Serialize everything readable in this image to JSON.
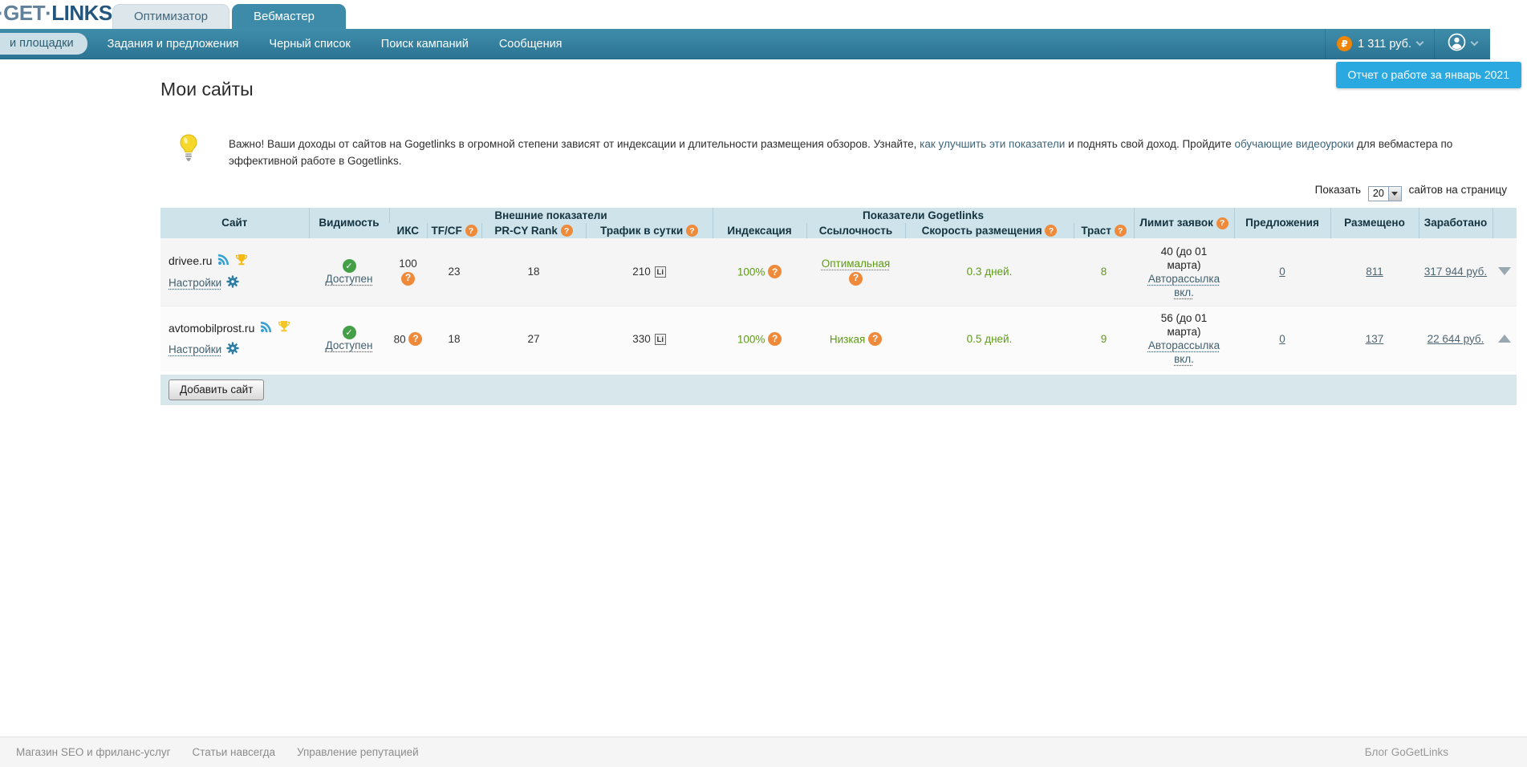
{
  "colors": {
    "accent_teal": "#35819f",
    "notification_blue": "#2aa9e0",
    "success_green": "#5d9c12",
    "badge_orange": "#ef8a3a",
    "trophy_gold": "#f2b61c"
  },
  "brand": {
    "prefix": "·GET·",
    "name": "LINKS"
  },
  "tabs": {
    "optimizer": "Оптимизатор",
    "webmaster": "Вебмастер"
  },
  "nav": {
    "item_platforms": "и площадки",
    "item_tasks": "Задания и предложения",
    "item_blacklist": "Черный список",
    "item_search": "Поиск кампаний",
    "item_messages": "Сообщения",
    "ruble": "₽",
    "balance": "1 311 руб."
  },
  "notification": {
    "text": "Отчет о работе за январь 2021"
  },
  "page": {
    "title": "Мои сайты"
  },
  "notice": {
    "part1": "Важно! Ваши доходы от сайтов на Gogetlinks в огромной степени зависят от индексации и длительности размещения обзоров. Узнайте, ",
    "link1": "как улучшить эти показатели",
    "part2": " и поднять свой доход. Пройдите ",
    "link2": "обучающие видеоуроки",
    "part3": " для вебмастера по эффективной работе в Gogetlinks."
  },
  "per_page": {
    "before": "Показать",
    "value": "20",
    "after": "сайтов на страницу"
  },
  "icons": {
    "question": "?",
    "check": "✓",
    "li": "Li"
  },
  "table": {
    "group_external": "Внешние показатели",
    "group_gogetlinks": "Показатели Gogetlinks",
    "col_site": "Сайт",
    "col_visibility": "Видимость",
    "col_iks": "ИКС",
    "col_tfcf": "TF/CF",
    "col_prcy": "PR-CY Rank",
    "col_traffic": "Трафик в сутки",
    "col_indexing": "Индексация",
    "col_linking": "Ссылочность",
    "col_speed": "Скорость размещения",
    "col_trust": "Траст",
    "col_limit": "Лимит заявок",
    "col_offers": "Предложения",
    "col_placed": "Размещено",
    "col_earned": "Заработано",
    "settings": "Настройки",
    "rows": [
      {
        "domain": "drivee.ru",
        "visibility": "Доступен",
        "iks": "100",
        "tfcf": "23",
        "prcy": "18",
        "traffic": "210",
        "indexing": "100%",
        "linking": "Оптимальная",
        "speed": "0.3 дней.",
        "trust": "8",
        "limit": "40 (до 01 марта)",
        "autosend": "Авторассылка вкл.",
        "offers": "0",
        "placed": "811",
        "earned": "317 944 руб."
      },
      {
        "domain": "avtomobilprost.ru",
        "visibility": "Доступен",
        "iks": "80",
        "tfcf": "18",
        "prcy": "27",
        "traffic": "330",
        "indexing": "100%",
        "linking": "Низкая",
        "speed": "0.5 дней.",
        "trust": "9",
        "limit": "56 (до 01 марта)",
        "autosend": "Авторассылка вкл.",
        "offers": "0",
        "placed": "137",
        "earned": "22 644 руб."
      }
    ],
    "add_site": "Добавить сайт"
  },
  "footer": {
    "link_shop": "Магазин SEO и фриланс-услуг",
    "link_articles": "Статьи навсегда",
    "link_reputation": "Управление репутацией",
    "link_blog": "Блог GoGetLinks"
  }
}
